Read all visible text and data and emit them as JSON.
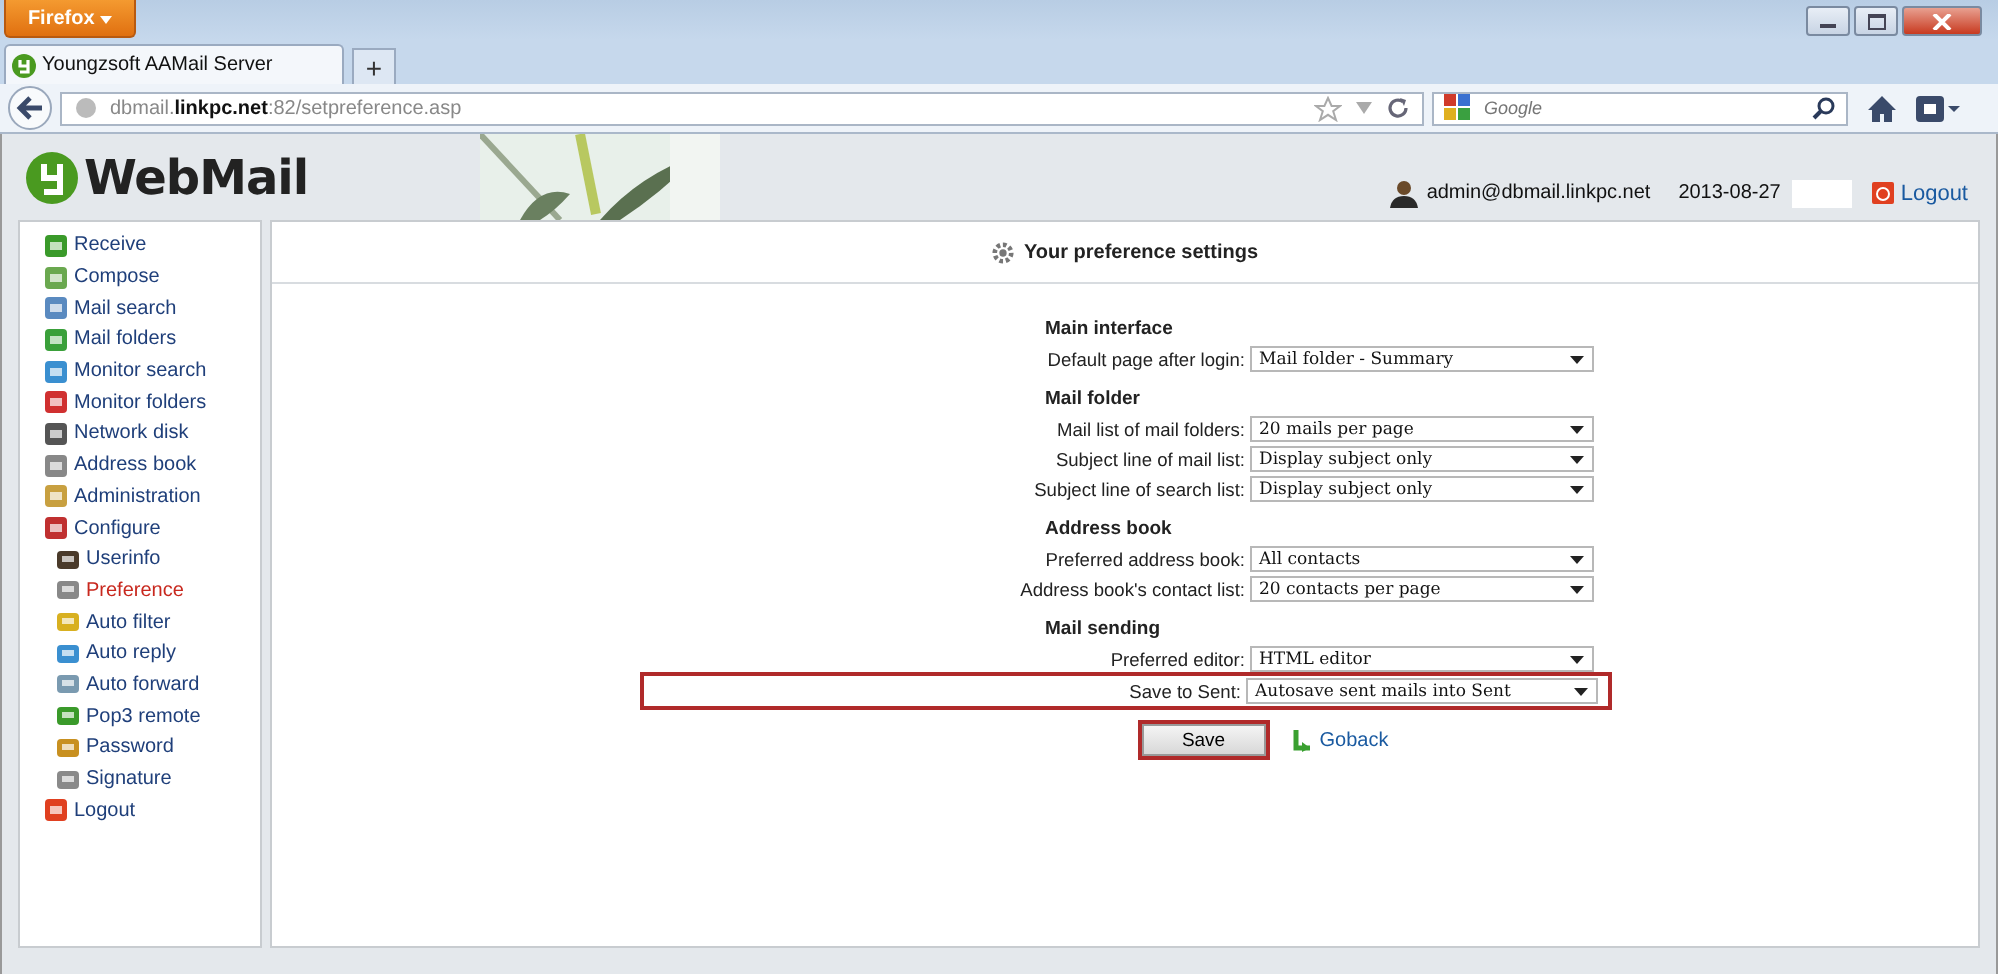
{
  "browser": {
    "menu_button": "Firefox",
    "tab_title": "Youngzsoft AAMail Server",
    "new_tab": "+",
    "url_host": "dbmail.",
    "url_domain": "linkpc.net",
    "url_path": ":82/setpreference.asp",
    "search_placeholder": "Google"
  },
  "header": {
    "logo": "WebMail",
    "user": "admin@dbmail.linkpc.net",
    "date": "2013-08-27",
    "logout": "Logout"
  },
  "sidebar": {
    "items": [
      {
        "label": "Receive",
        "selected": false
      },
      {
        "label": "Compose",
        "selected": false
      },
      {
        "label": "Mail search",
        "selected": false
      },
      {
        "label": "Mail folders",
        "selected": false
      },
      {
        "label": "Monitor search",
        "selected": false
      },
      {
        "label": "Monitor folders",
        "selected": false
      },
      {
        "label": "Network disk",
        "selected": false
      },
      {
        "label": "Address book",
        "selected": false
      },
      {
        "label": "Administration",
        "selected": false
      },
      {
        "label": "Configure",
        "selected": false,
        "children": [
          {
            "label": "Userinfo",
            "selected": false
          },
          {
            "label": "Preference",
            "selected": true
          },
          {
            "label": "Auto filter",
            "selected": false
          },
          {
            "label": "Auto reply",
            "selected": false
          },
          {
            "label": "Auto forward",
            "selected": false
          },
          {
            "label": "Pop3 remote",
            "selected": false
          },
          {
            "label": "Password",
            "selected": false
          },
          {
            "label": "Signature",
            "selected": false
          }
        ]
      },
      {
        "label": "Logout",
        "selected": false
      }
    ]
  },
  "panel": {
    "title": "Your preference settings",
    "sections": [
      {
        "heading": "Main interface",
        "rows": [
          {
            "label": "Default page after login:",
            "value": "Mail folder - Summary",
            "highlighted": false
          }
        ]
      },
      {
        "heading": "Mail folder",
        "rows": [
          {
            "label": "Mail list of mail folders:",
            "value": "20 mails per page",
            "highlighted": false
          },
          {
            "label": "Subject line of mail list:",
            "value": "Display subject only",
            "highlighted": false
          },
          {
            "label": "Subject line of search list:",
            "value": "Display subject only",
            "highlighted": false
          }
        ]
      },
      {
        "heading": "Address book",
        "rows": [
          {
            "label": "Preferred address book:",
            "value": "All contacts",
            "highlighted": false
          },
          {
            "label": "Address book's contact list:",
            "value": "20 contacts per page",
            "highlighted": false
          }
        ]
      },
      {
        "heading": "Mail sending",
        "rows": [
          {
            "label": "Preferred editor:",
            "value": "HTML editor",
            "highlighted": false
          },
          {
            "label": "Save to Sent:",
            "value": "Autosave sent mails into Sent",
            "highlighted": true
          }
        ]
      }
    ],
    "save": {
      "label": "Save",
      "highlighted": true
    },
    "goback": "Goback"
  }
}
